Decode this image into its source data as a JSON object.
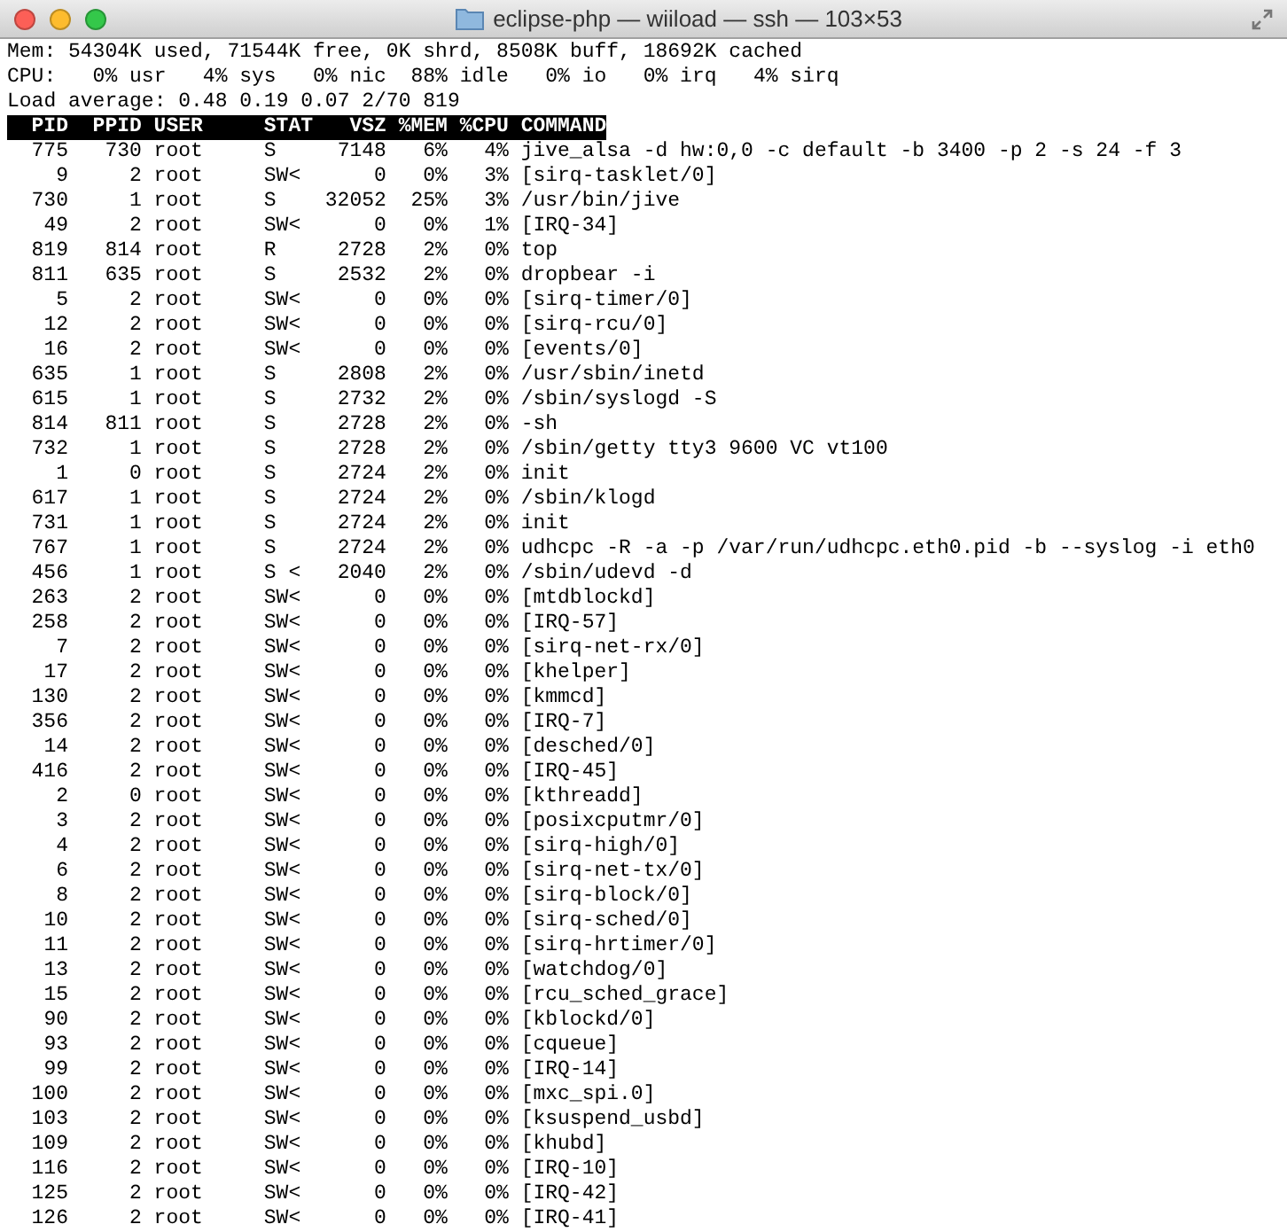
{
  "window": {
    "title": "eclipse-php — wiiload — ssh — 103×53"
  },
  "summary": [
    "Mem: 54304K used, 71544K free, 0K shrd, 8508K buff, 18692K cached",
    "CPU:   0% usr   4% sys   0% nic  88% idle   0% io   0% irq   4% sirq",
    "Load average: 0.48 0.19 0.07 2/70 819"
  ],
  "table": {
    "columns": [
      "PID",
      "PPID",
      "USER",
      "STAT",
      "VSZ",
      "%MEM",
      "%CPU",
      "COMMAND"
    ],
    "rows": [
      [
        "775",
        "730",
        "root",
        "S",
        "7148",
        "6%",
        "4%",
        "jive_alsa -d hw:0,0 -c default -b 3400 -p 2 -s 24 -f 3"
      ],
      [
        "9",
        "2",
        "root",
        "SW<",
        "0",
        "0%",
        "3%",
        "[sirq-tasklet/0]"
      ],
      [
        "730",
        "1",
        "root",
        "S",
        "32052",
        "25%",
        "3%",
        "/usr/bin/jive"
      ],
      [
        "49",
        "2",
        "root",
        "SW<",
        "0",
        "0%",
        "1%",
        "[IRQ-34]"
      ],
      [
        "819",
        "814",
        "root",
        "R",
        "2728",
        "2%",
        "0%",
        "top"
      ],
      [
        "811",
        "635",
        "root",
        "S",
        "2532",
        "2%",
        "0%",
        "dropbear -i"
      ],
      [
        "5",
        "2",
        "root",
        "SW<",
        "0",
        "0%",
        "0%",
        "[sirq-timer/0]"
      ],
      [
        "12",
        "2",
        "root",
        "SW<",
        "0",
        "0%",
        "0%",
        "[sirq-rcu/0]"
      ],
      [
        "16",
        "2",
        "root",
        "SW<",
        "0",
        "0%",
        "0%",
        "[events/0]"
      ],
      [
        "635",
        "1",
        "root",
        "S",
        "2808",
        "2%",
        "0%",
        "/usr/sbin/inetd"
      ],
      [
        "615",
        "1",
        "root",
        "S",
        "2732",
        "2%",
        "0%",
        "/sbin/syslogd -S"
      ],
      [
        "814",
        "811",
        "root",
        "S",
        "2728",
        "2%",
        "0%",
        "-sh"
      ],
      [
        "732",
        "1",
        "root",
        "S",
        "2728",
        "2%",
        "0%",
        "/sbin/getty tty3 9600 VC vt100"
      ],
      [
        "1",
        "0",
        "root",
        "S",
        "2724",
        "2%",
        "0%",
        "init"
      ],
      [
        "617",
        "1",
        "root",
        "S",
        "2724",
        "2%",
        "0%",
        "/sbin/klogd"
      ],
      [
        "731",
        "1",
        "root",
        "S",
        "2724",
        "2%",
        "0%",
        "init"
      ],
      [
        "767",
        "1",
        "root",
        "S",
        "2724",
        "2%",
        "0%",
        "udhcpc -R -a -p /var/run/udhcpc.eth0.pid -b --syslog -i eth0"
      ],
      [
        "456",
        "1",
        "root",
        "S <",
        "2040",
        "2%",
        "0%",
        "/sbin/udevd -d"
      ],
      [
        "263",
        "2",
        "root",
        "SW<",
        "0",
        "0%",
        "0%",
        "[mtdblockd]"
      ],
      [
        "258",
        "2",
        "root",
        "SW<",
        "0",
        "0%",
        "0%",
        "[IRQ-57]"
      ],
      [
        "7",
        "2",
        "root",
        "SW<",
        "0",
        "0%",
        "0%",
        "[sirq-net-rx/0]"
      ],
      [
        "17",
        "2",
        "root",
        "SW<",
        "0",
        "0%",
        "0%",
        "[khelper]"
      ],
      [
        "130",
        "2",
        "root",
        "SW<",
        "0",
        "0%",
        "0%",
        "[kmmcd]"
      ],
      [
        "356",
        "2",
        "root",
        "SW<",
        "0",
        "0%",
        "0%",
        "[IRQ-7]"
      ],
      [
        "14",
        "2",
        "root",
        "SW<",
        "0",
        "0%",
        "0%",
        "[desched/0]"
      ],
      [
        "416",
        "2",
        "root",
        "SW<",
        "0",
        "0%",
        "0%",
        "[IRQ-45]"
      ],
      [
        "2",
        "0",
        "root",
        "SW<",
        "0",
        "0%",
        "0%",
        "[kthreadd]"
      ],
      [
        "3",
        "2",
        "root",
        "SW<",
        "0",
        "0%",
        "0%",
        "[posixcputmr/0]"
      ],
      [
        "4",
        "2",
        "root",
        "SW<",
        "0",
        "0%",
        "0%",
        "[sirq-high/0]"
      ],
      [
        "6",
        "2",
        "root",
        "SW<",
        "0",
        "0%",
        "0%",
        "[sirq-net-tx/0]"
      ],
      [
        "8",
        "2",
        "root",
        "SW<",
        "0",
        "0%",
        "0%",
        "[sirq-block/0]"
      ],
      [
        "10",
        "2",
        "root",
        "SW<",
        "0",
        "0%",
        "0%",
        "[sirq-sched/0]"
      ],
      [
        "11",
        "2",
        "root",
        "SW<",
        "0",
        "0%",
        "0%",
        "[sirq-hrtimer/0]"
      ],
      [
        "13",
        "2",
        "root",
        "SW<",
        "0",
        "0%",
        "0%",
        "[watchdog/0]"
      ],
      [
        "15",
        "2",
        "root",
        "SW<",
        "0",
        "0%",
        "0%",
        "[rcu_sched_grace]"
      ],
      [
        "90",
        "2",
        "root",
        "SW<",
        "0",
        "0%",
        "0%",
        "[kblockd/0]"
      ],
      [
        "93",
        "2",
        "root",
        "SW<",
        "0",
        "0%",
        "0%",
        "[cqueue]"
      ],
      [
        "99",
        "2",
        "root",
        "SW<",
        "0",
        "0%",
        "0%",
        "[IRQ-14]"
      ],
      [
        "100",
        "2",
        "root",
        "SW<",
        "0",
        "0%",
        "0%",
        "[mxc_spi.0]"
      ],
      [
        "103",
        "2",
        "root",
        "SW<",
        "0",
        "0%",
        "0%",
        "[ksuspend_usbd]"
      ],
      [
        "109",
        "2",
        "root",
        "SW<",
        "0",
        "0%",
        "0%",
        "[khubd]"
      ],
      [
        "116",
        "2",
        "root",
        "SW<",
        "0",
        "0%",
        "0%",
        "[IRQ-10]"
      ],
      [
        "125",
        "2",
        "root",
        "SW<",
        "0",
        "0%",
        "0%",
        "[IRQ-42]"
      ],
      [
        "126",
        "2",
        "root",
        "SW<",
        "0",
        "0%",
        "0%",
        "[IRQ-41]"
      ]
    ]
  }
}
